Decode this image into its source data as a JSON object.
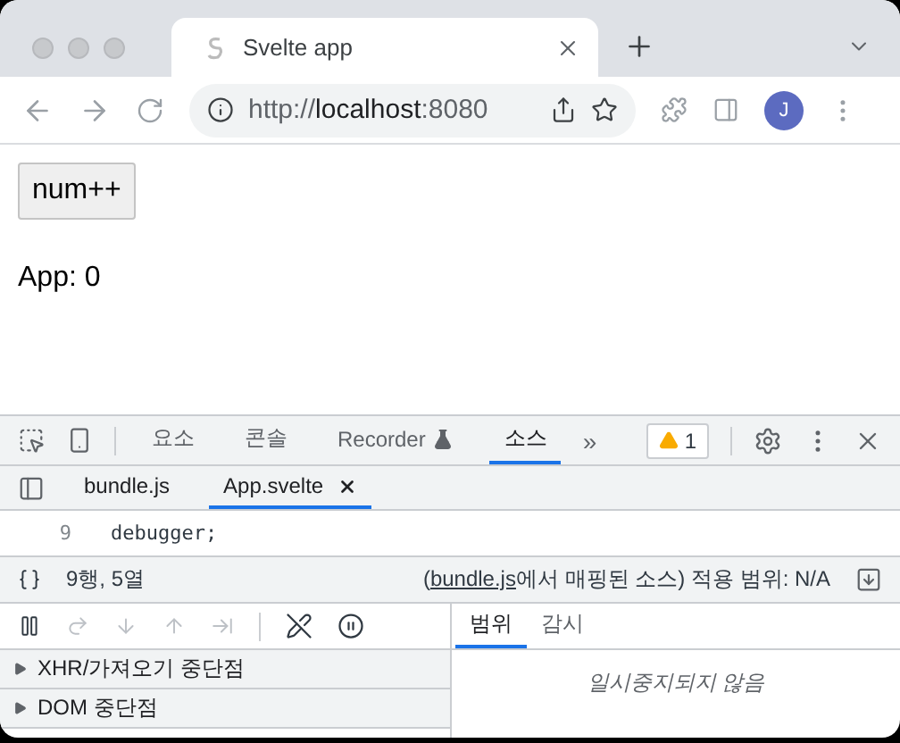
{
  "browser": {
    "tabs": [
      {
        "title": "Svelte app",
        "selected": true
      }
    ],
    "address": {
      "scheme": "http://",
      "host": "localhost",
      "port": ":8080"
    },
    "avatar": "J"
  },
  "page": {
    "button": "num++",
    "output": "App: 0"
  },
  "devtools": {
    "tabs": [
      {
        "label": "요소",
        "selected": false
      },
      {
        "label": "콘솔",
        "selected": false
      },
      {
        "label": "Recorder",
        "selected": false
      },
      {
        "label": "소스",
        "selected": true
      }
    ],
    "more": "»",
    "warnings": "1",
    "files": [
      {
        "name": "bundle.js",
        "selected": false
      },
      {
        "name": "App.svelte",
        "selected": true
      }
    ],
    "code": [
      {
        "line": "9",
        "text": "debugger;"
      }
    ],
    "status": {
      "position": "9행, 5열",
      "open_paren": "(",
      "link": "bundle.js",
      "mapped": "에서 매핑된 소스) 적용 범위: N/A"
    },
    "sections": [
      {
        "label": "XHR/가져오기 중단점",
        "expanded": false
      },
      {
        "label": "DOM 중단점",
        "expanded": false
      }
    ],
    "side_tabs": [
      {
        "label": "범위",
        "selected": true
      },
      {
        "label": "감시",
        "selected": false
      }
    ],
    "paused_message": "일시중지되지 않음"
  }
}
